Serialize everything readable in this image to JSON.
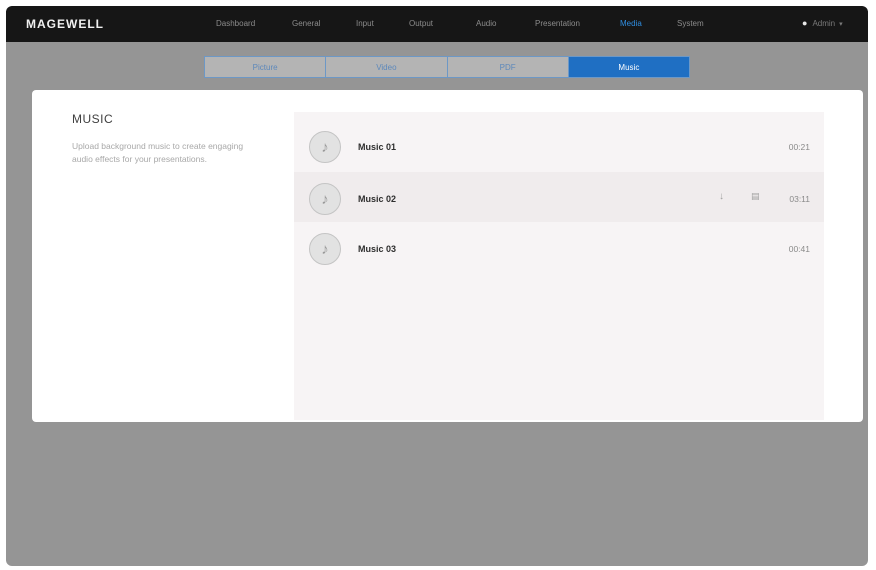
{
  "brand": "MAGEWELL",
  "nav": {
    "items": [
      "Dashboard",
      "General",
      "Input",
      "Output",
      "Audio",
      "Presentation",
      "Media",
      "System"
    ],
    "active": "Media"
  },
  "user": {
    "name": "Admin",
    "icon": "user-icon",
    "caret_icon": "chevron-down-icon"
  },
  "media_tabs": {
    "items": [
      "Picture",
      "Video",
      "PDF",
      "Music"
    ],
    "active": "Music"
  },
  "music_section": {
    "title": "MUSIC",
    "description": "Upload background music to create engaging audio effects for your presentations."
  },
  "music_list": [
    {
      "name": "Music 01",
      "duration": "00:21",
      "icon": "music-note-icon"
    },
    {
      "name": "Music 02",
      "duration": "03:11",
      "icon": "music-note-icon",
      "actions": [
        "download-icon",
        "delete-icon"
      ]
    },
    {
      "name": "Music 03",
      "duration": "00:41",
      "icon": "music-note-icon"
    }
  ],
  "colors": {
    "topbar": "#161616",
    "accent": "#1f6fc3",
    "nav_active": "#2f8de0",
    "overlay": "#959595"
  }
}
